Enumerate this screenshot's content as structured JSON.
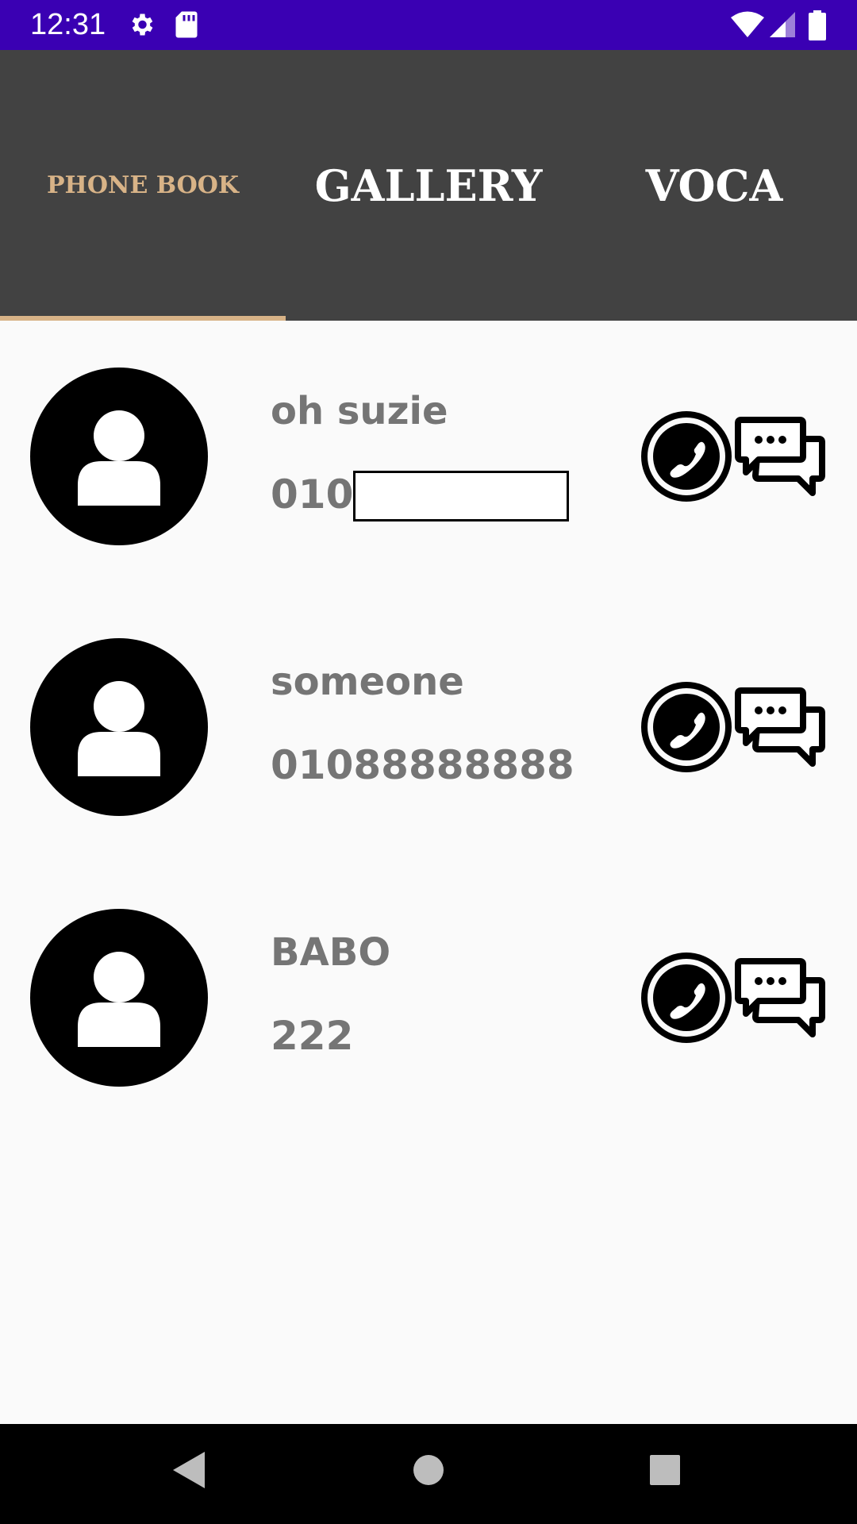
{
  "status_bar": {
    "time": "12:31",
    "icons": [
      "settings-icon",
      "sd-card-icon",
      "wifi-icon",
      "signal-icon",
      "battery-icon"
    ]
  },
  "tabs": [
    {
      "label": "PHONE BOOK",
      "selected": true
    },
    {
      "label": "GALLERY",
      "selected": false
    },
    {
      "label": "VOCA",
      "selected": false
    }
  ],
  "contacts": [
    {
      "name": "oh suzie",
      "phone": "010"
    },
    {
      "name": "someone",
      "phone": "01088888888"
    },
    {
      "name": "BABO",
      "phone": "222"
    }
  ],
  "row_icons": {
    "avatar": "person-icon",
    "call": "phone-call-icon",
    "message": "chat-bubbles-icon"
  },
  "nav_bar": {
    "buttons": [
      "back-icon",
      "home-icon",
      "recents-icon"
    ]
  },
  "colors": {
    "status_bar": "#3a00b3",
    "tab_bar": "#424242",
    "accent": "#d8b387",
    "text": "#757575"
  }
}
